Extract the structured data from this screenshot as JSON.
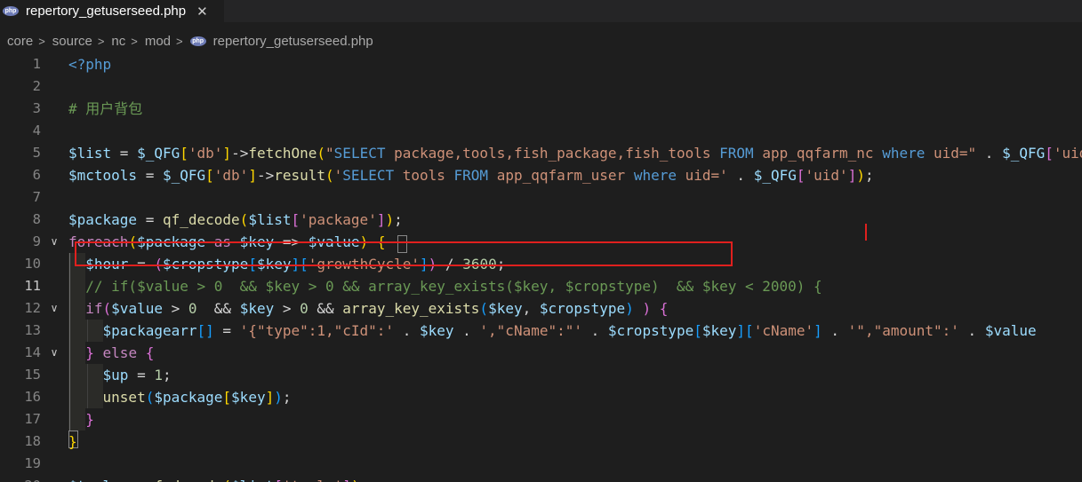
{
  "tab": {
    "filename": "repertory_getuserseed.php",
    "icon": "php-file-icon",
    "badge_text": "php",
    "close_glyph": "✕"
  },
  "breadcrumb": {
    "parts": [
      "core",
      "source",
      "nc",
      "mod"
    ],
    "separator": ">",
    "file": "repertory_getuserseed.php"
  },
  "editor": {
    "active_line": 11,
    "line_numbers": [
      "1",
      "2",
      "3",
      "4",
      "5",
      "6",
      "7",
      "8",
      "9",
      "10",
      "11",
      "12",
      "13",
      "14",
      "15",
      "16",
      "17",
      "18",
      "19",
      "20"
    ],
    "lines": [
      [
        [
          "tag",
          "<?php"
        ]
      ],
      [],
      [
        [
          "cmt",
          "# 用户背包"
        ]
      ],
      [],
      [
        [
          "var",
          "$list"
        ],
        [
          "op",
          " = "
        ],
        [
          "var",
          "$_QFG"
        ],
        [
          "p1",
          "["
        ],
        [
          "str",
          "'db'"
        ],
        [
          "p1",
          "]"
        ],
        [
          "op",
          "->"
        ],
        [
          "fn",
          "fetchOne"
        ],
        [
          "p1",
          "("
        ],
        [
          "str",
          "\""
        ],
        [
          "sql",
          "SELECT"
        ],
        [
          "str",
          " package,tools,fish_package,fish_tools "
        ],
        [
          "sql",
          "FROM"
        ],
        [
          "str",
          " app_qqfarm_nc "
        ],
        [
          "sql",
          "where"
        ],
        [
          "str",
          " uid=\""
        ],
        [
          "op",
          " . "
        ],
        [
          "var",
          "$_QFG"
        ],
        [
          "p2",
          "["
        ],
        [
          "str",
          "'uid'"
        ],
        [
          "p2",
          "]"
        ],
        [
          "p1",
          ")"
        ],
        [
          "op",
          ";"
        ]
      ],
      [
        [
          "var",
          "$mctools"
        ],
        [
          "op",
          " = "
        ],
        [
          "var",
          "$_QFG"
        ],
        [
          "p1",
          "["
        ],
        [
          "str",
          "'db'"
        ],
        [
          "p1",
          "]"
        ],
        [
          "op",
          "->"
        ],
        [
          "fn",
          "result"
        ],
        [
          "p1",
          "("
        ],
        [
          "str",
          "'"
        ],
        [
          "sql",
          "SELECT"
        ],
        [
          "str",
          " tools "
        ],
        [
          "sql",
          "FROM"
        ],
        [
          "str",
          " app_qqfarm_user "
        ],
        [
          "sql",
          "where"
        ],
        [
          "str",
          " uid='"
        ],
        [
          "op",
          " . "
        ],
        [
          "var",
          "$_QFG"
        ],
        [
          "p2",
          "["
        ],
        [
          "str",
          "'uid'"
        ],
        [
          "p2",
          "]"
        ],
        [
          "p1",
          ")"
        ],
        [
          "op",
          ";"
        ]
      ],
      [],
      [
        [
          "var",
          "$package"
        ],
        [
          "op",
          " = "
        ],
        [
          "fn",
          "qf_decode"
        ],
        [
          "p1",
          "("
        ],
        [
          "var",
          "$list"
        ],
        [
          "p2",
          "["
        ],
        [
          "str",
          "'package'"
        ],
        [
          "p2",
          "]"
        ],
        [
          "p1",
          ")"
        ],
        [
          "op",
          ";"
        ]
      ],
      [
        [
          "kw",
          "foreach"
        ],
        [
          "p1",
          "("
        ],
        [
          "var",
          "$package"
        ],
        [
          "kw",
          " as "
        ],
        [
          "var",
          "$key"
        ],
        [
          "op",
          " => "
        ],
        [
          "var",
          "$value"
        ],
        [
          "p1",
          ")"
        ],
        [
          "op",
          " "
        ],
        [
          "p1",
          "{"
        ]
      ],
      [
        [
          "op",
          "  "
        ],
        [
          "var",
          "$hour"
        ],
        [
          "op",
          " = "
        ],
        [
          "p2",
          "("
        ],
        [
          "var",
          "$cropstype"
        ],
        [
          "p3",
          "["
        ],
        [
          "var",
          "$key"
        ],
        [
          "p3",
          "]"
        ],
        [
          "p3",
          "["
        ],
        [
          "str",
          "'growthCycle'"
        ],
        [
          "p3",
          "]"
        ],
        [
          "p2",
          ")"
        ],
        [
          "op",
          " / "
        ],
        [
          "num",
          "3600"
        ],
        [
          "op",
          ";"
        ]
      ],
      [
        [
          "op",
          "  "
        ],
        [
          "cmt",
          "// if($value > 0  && $key > 0 && array_key_exists($key, $cropstype)  && $key < 2000) {"
        ]
      ],
      [
        [
          "op",
          "  "
        ],
        [
          "kw",
          "if"
        ],
        [
          "p2",
          "("
        ],
        [
          "var",
          "$value"
        ],
        [
          "op",
          " > "
        ],
        [
          "num",
          "0"
        ],
        [
          "op",
          "  && "
        ],
        [
          "var",
          "$key"
        ],
        [
          "op",
          " > "
        ],
        [
          "num",
          "0"
        ],
        [
          "op",
          " && "
        ],
        [
          "fn",
          "array_key_exists"
        ],
        [
          "p3",
          "("
        ],
        [
          "var",
          "$key"
        ],
        [
          "op",
          ", "
        ],
        [
          "var",
          "$cropstype"
        ],
        [
          "p3",
          ")"
        ],
        [
          "op",
          " "
        ],
        [
          "p2",
          ")"
        ],
        [
          "op",
          " "
        ],
        [
          "p2",
          "{"
        ]
      ],
      [
        [
          "op",
          "    "
        ],
        [
          "var",
          "$packagearr"
        ],
        [
          "p3",
          "[]"
        ],
        [
          "op",
          " = "
        ],
        [
          "str",
          "'{\"type\":1,\"cId\":'"
        ],
        [
          "op",
          " . "
        ],
        [
          "var",
          "$key"
        ],
        [
          "op",
          " . "
        ],
        [
          "str",
          "',\"cName\":\"'"
        ],
        [
          "op",
          " . "
        ],
        [
          "var",
          "$cropstype"
        ],
        [
          "p3",
          "["
        ],
        [
          "var",
          "$key"
        ],
        [
          "p3",
          "]"
        ],
        [
          "p3",
          "["
        ],
        [
          "str",
          "'cName'"
        ],
        [
          "p3",
          "]"
        ],
        [
          "op",
          " . "
        ],
        [
          "str",
          "'\",\"amount\":'"
        ],
        [
          "op",
          " . "
        ],
        [
          "var",
          "$value"
        ]
      ],
      [
        [
          "op",
          "  "
        ],
        [
          "p2",
          "}"
        ],
        [
          "kw",
          " else "
        ],
        [
          "p2",
          "{"
        ]
      ],
      [
        [
          "op",
          "    "
        ],
        [
          "var",
          "$up"
        ],
        [
          "op",
          " = "
        ],
        [
          "num",
          "1"
        ],
        [
          "op",
          ";"
        ]
      ],
      [
        [
          "op",
          "    "
        ],
        [
          "fn",
          "unset"
        ],
        [
          "p3",
          "("
        ],
        [
          "var",
          "$package"
        ],
        [
          "p1",
          "["
        ],
        [
          "var",
          "$key"
        ],
        [
          "p1",
          "]"
        ],
        [
          "p3",
          ")"
        ],
        [
          "op",
          ";"
        ]
      ],
      [
        [
          "op",
          "  "
        ],
        [
          "p2",
          "}"
        ]
      ],
      [
        [
          "p1",
          "}"
        ]
      ],
      [],
      [
        [
          "var",
          "$tools"
        ],
        [
          "op",
          " = "
        ],
        [
          "fn",
          "qf_decode"
        ],
        [
          "p1",
          "("
        ],
        [
          "var",
          "$list"
        ],
        [
          "p2",
          "["
        ],
        [
          "str",
          "'tools'"
        ],
        [
          "p2",
          "]"
        ],
        [
          "p1",
          ")"
        ],
        [
          "op",
          ";"
        ]
      ]
    ]
  }
}
